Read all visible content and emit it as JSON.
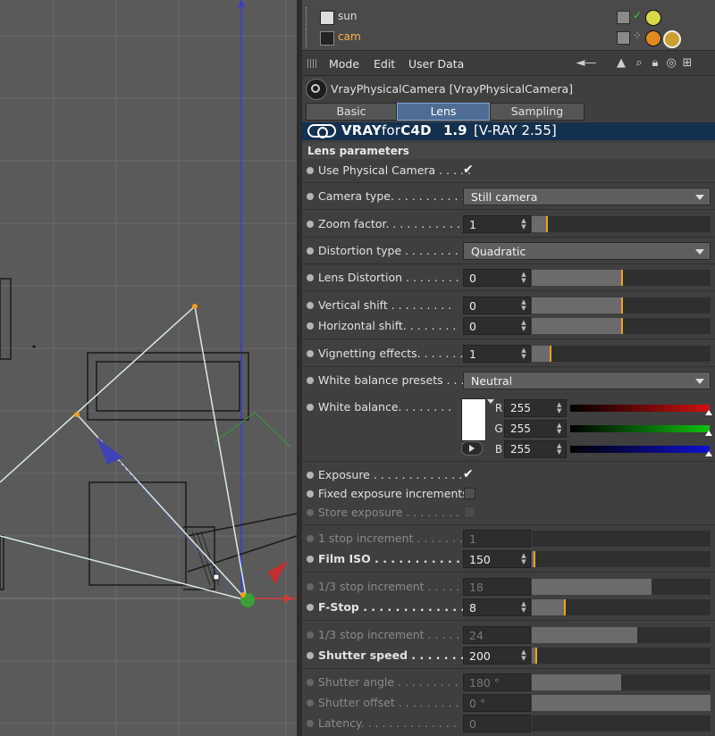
{
  "objects": [
    {
      "name": "sun",
      "highlight": false
    },
    {
      "name": "cam",
      "highlight": true
    }
  ],
  "menu": {
    "mode": "Mode",
    "edit": "Edit",
    "user_data": "User Data"
  },
  "object": {
    "title": "VrayPhysicalCamera [VrayPhysicalCamera]"
  },
  "tabs": [
    "Basic",
    "Lens parameters",
    "Sampling"
  ],
  "active_tab": "Lens parameters",
  "banner": {
    "brand_bold": "VRAY",
    "brand_thin": "for",
    "brand_tail": "C4D",
    "version": "1.9",
    "engine": "[V-RAY 2.55]"
  },
  "section": "Lens parameters",
  "params": {
    "use_physical_camera": {
      "label": "Use Physical Camera . . . . .",
      "checked": true
    },
    "camera_type": {
      "label": "Camera type. . . . . . . . . . .",
      "value": "Still camera"
    },
    "zoom_factor": {
      "label": "Zoom factor. . . . . . . . . . .",
      "value": "1",
      "level": 0.08
    },
    "distortion_type": {
      "label": "Distortion type . . . . . . . .",
      "value": "Quadratic"
    },
    "lens_distortion": {
      "label": "Lens Distortion . . . . . . . .",
      "value": "0",
      "level": 0.5
    },
    "vertical_shift": {
      "label": "Vertical shift . . . . . . . . .",
      "value": "0",
      "level": 0.5
    },
    "horizontal_shift": {
      "label": "Horizontal shift. . . . . . . .",
      "value": "0",
      "level": 0.5
    },
    "vignetting_effects": {
      "label": "Vignetting effects. . . . . . .",
      "value": "1",
      "level": 0.1
    },
    "white_balance_presets": {
      "label": "White balance presets . . .",
      "value": "Neutral"
    },
    "white_balance": {
      "label": "White balance. . . . . . . .",
      "r": "255",
      "g": "255",
      "b": "255"
    },
    "exposure": {
      "label": "Exposure . . . . . . . . . . . . .",
      "checked": true
    },
    "fixed_exposure_increments": {
      "label": "Fixed exposure increments",
      "checked": false
    },
    "store_exposure": {
      "label": "Store exposure . . . . . . . . .",
      "checked": false
    },
    "one_stop_increment": {
      "label": "1 stop increment . . . . . . . .",
      "value": "1",
      "level": 0
    },
    "film_iso": {
      "label": "Film ISO . . . . . . . . . . . . .",
      "value": "150",
      "level": 0.01
    },
    "third_stop_increment_iso": {
      "label": "1/3 stop increment . . . . . .",
      "value": "18",
      "level": 0.67
    },
    "f_stop": {
      "label": "F-Stop . . . . . . . . . . . . . . .",
      "value": "8",
      "level": 0.18
    },
    "third_stop_increment_f": {
      "label": "1/3 stop increment . . . . . .",
      "value": "24",
      "level": 0.59
    },
    "shutter_speed": {
      "label": "Shutter speed . . . . . . . . . .",
      "value": "200",
      "level": 0.02
    },
    "shutter_angle": {
      "label": "Shutter angle . . . . . . . . . .",
      "value": "180 °",
      "level": 0.5
    },
    "shutter_offset": {
      "label": "Shutter offset . . . . . . . . .",
      "value": "0 °",
      "level": 1.0
    },
    "latency": {
      "label": "Latency. . . . . . . . . . . . . .",
      "value": "0",
      "level": 0
    }
  },
  "colors": {
    "accent": "#f0a020",
    "tab_active": "#4f6d94",
    "banner": "#14304f",
    "cam_label": "#ffb347"
  }
}
